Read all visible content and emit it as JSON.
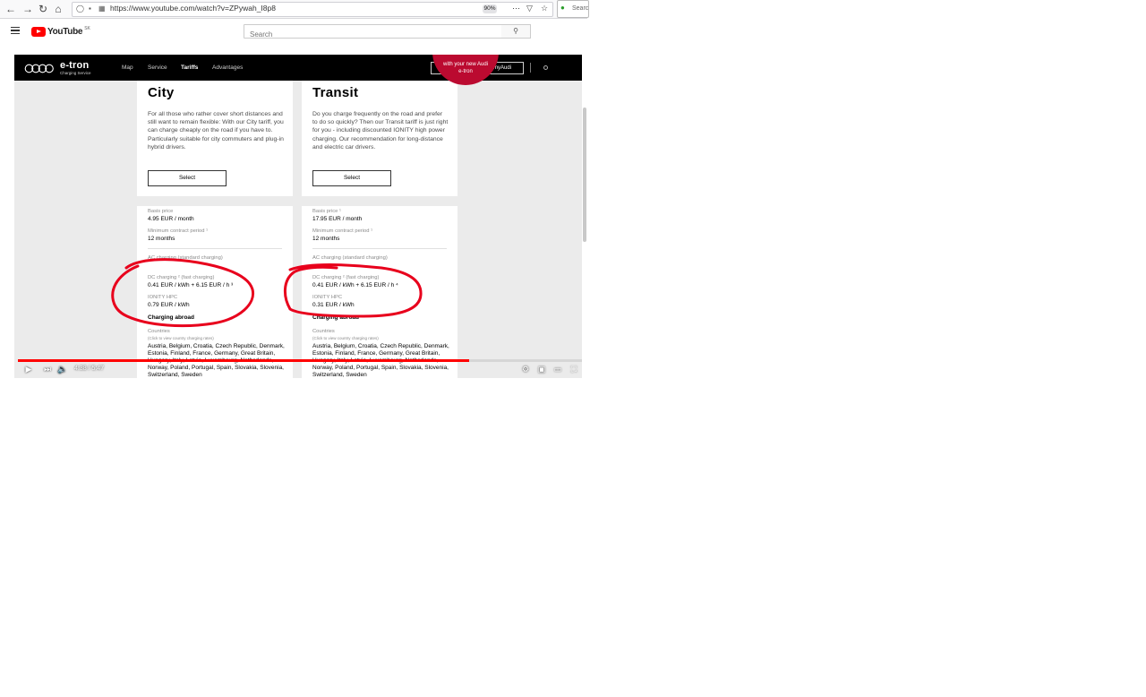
{
  "browser": {
    "url": "https://www.youtube.com/watch?v=ZPywah_I8p8",
    "zoom": "90%",
    "search_placeholder": "Searc"
  },
  "youtube": {
    "logo_text": "YouTube",
    "country_code": "SK",
    "search_placeholder": "Search"
  },
  "site": {
    "brand_title": "e-tron",
    "brand_subtitle": "Charging Service",
    "nav": [
      "Map",
      "Service",
      "Tariffs",
      "Advantages"
    ],
    "active_nav": "Tariffs",
    "register_label": "Register / Login with myAudi",
    "badge_text_line1": "with your new Audi",
    "badge_text_line2": "e-tron"
  },
  "tariffs": [
    {
      "title": "City",
      "description": "For all those who rather cover short distances and still want to remain flexible: With our City tariff, you can charge cheaply on the road if you have to. Particularly suitable for city commuters and plug-in hybrid drivers.",
      "select_label": "Select",
      "basis_price_label": "Basis price",
      "basis_price": "4.95 EUR / month",
      "min_contract_label": "Minimum contract period ¹",
      "min_contract": "12 months",
      "ac_label": "AC charging (standard charging)",
      "dc_label": "DC charging ² (fast charging)",
      "dc_value": "0.41 EUR / kWh + 6.15 EUR / h ³",
      "ionity_label": "IONITY HPC",
      "ionity_value": "0.79 EUR / kWh",
      "abroad_label": "Charging abroad",
      "countries_label": "Countries",
      "countries_note": "(Click to view country charging rates)",
      "countries": "Austria, Belgium, Croatia, Czech Republic, Denmark, Estonia, Finland, France, Germany, Great Britain, Hungary, Italy, Latvia, Luxembourg, Netherlands, Norway, Poland, Portugal, Spain, Slovakia, Slovenia, Switzerland, Sweden"
    },
    {
      "title": "Transit",
      "description": "Do you charge frequently on the road and prefer to do so quickly? Then our Transit tariff is just right for you - including discounted IONITY high power charging. Our recommendation for long-distance and electric car drivers.",
      "select_label": "Select",
      "basis_price_label": "Basis price ¹",
      "basis_price": "17.95 EUR / month",
      "min_contract_label": "Minimum contract period ¹",
      "min_contract": "12 months",
      "ac_label": "AC charging (standard charging)",
      "dc_label": "DC charging ² (fast charging)",
      "dc_value": "0.41 EUR / kWh + 6.15 EUR / h ⁴",
      "ionity_label": "IONITY HPC",
      "ionity_value": "0.31 EUR / kWh",
      "abroad_label": "Charging abroad",
      "countries_label": "Countries",
      "countries_note": "(Click to view country charging rates)",
      "countries": "Austria, Belgium, Croatia, Czech Republic, Denmark, Estonia, Finland, France, Germany, Great Britain, Hungary, Italy, Latvia, Luxembourg, Netherlands, Norway, Poland, Portugal, Spain, Slovakia, Slovenia, Switzerland, Sweden"
    }
  ],
  "player": {
    "time": "4:38 / 5:47",
    "progress_fraction": 0.8,
    "icons": [
      "play-icon",
      "next-icon",
      "volume-icon",
      "settings-icon",
      "miniplayer-icon",
      "theater-icon",
      "fullscreen-icon"
    ]
  },
  "colors": {
    "audi_red": "#bb0a30",
    "annotation_red": "#e8001c",
    "yt_red": "#ff0000"
  }
}
